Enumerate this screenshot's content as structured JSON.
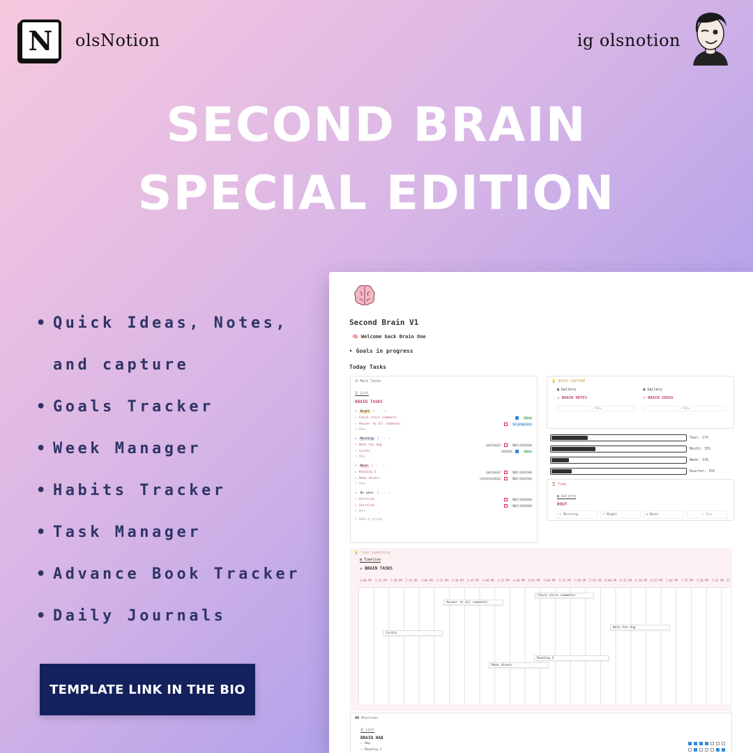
{
  "brand": {
    "logo_letter": "N",
    "name": "olsNotion"
  },
  "handle": "ig olsnotion",
  "title": {
    "line1": "SECOND BRAIN",
    "line2": "SPECIAL EDITION"
  },
  "features": [
    "Quick Ideas, Notes, and capture",
    "Goals Tracker",
    "Week Manager",
    "Habits Tracker",
    "Task Manager",
    "Advance Book Tracker",
    "Daily Journals"
  ],
  "cta": "TEMPLATE LINK IN THE BIO",
  "colors": {
    "cta_bg": "#14215c",
    "feature_text": "#2f3466",
    "accent_pink": "#c4457a"
  },
  "screenshot": {
    "page_title": "Second Brain V1",
    "welcome": "🧠 Welcome back Brain One",
    "goals": "‣ Goals in progress",
    "today": "Today Tasks",
    "main_tasks": {
      "view_label": "☰ Main Tasks",
      "tab": "☰ List",
      "heading": "BRAIN TASKS",
      "groups": [
        {
          "label": "Night",
          "color": "#f6e2b8",
          "items": [
            {
              "name": "Check store comments",
              "tag": "",
              "checked": true,
              "status": "Done",
              "kind": "done"
            },
            {
              "name": "Answer to all comments",
              "tag": "",
              "checked": false,
              "status": "In progress",
              "kind": "prog"
            }
          ]
        },
        {
          "label": "Morning",
          "color": "#dbe6f5",
          "items": [
            {
              "name": "Walk the dog",
              "tag": "personal",
              "checked": false,
              "status": "Not started",
              "kind": "ns"
            },
            {
              "name": "Cardio",
              "tag": "health",
              "checked": true,
              "status": "Done",
              "kind": "done"
            }
          ]
        },
        {
          "label": "Noon",
          "color": "#f8d9d9",
          "items": [
            {
              "name": "Reading 2",
              "tag": "personal",
              "checked": false,
              "status": "Not started",
              "kind": "ns"
            },
            {
              "name": "Make dinner",
              "tag": "relationship",
              "checked": false,
              "status": "Not started",
              "kind": "ns"
            }
          ]
        },
        {
          "label": "No when",
          "color": "#fff",
          "items": [
            {
              "name": "Untitled",
              "tag": "",
              "checked": false,
              "status": "Not started",
              "kind": "ns"
            },
            {
              "name": "Untitled",
              "tag": "",
              "checked": false,
              "status": "Not started",
              "kind": "ns"
            }
          ]
        }
      ],
      "add_group": "+ Add a group",
      "new": "+ New"
    },
    "quick_capture": {
      "label": "💡 QUICK CAPTURE",
      "gallery_a": "▦ Gallery",
      "gallery_b": "▦ Gallery",
      "notes": "↗ BRAIN NOTES",
      "ideas": "↗ BRAIN IDEAS",
      "new": "+ New"
    },
    "progress": [
      {
        "label": "Year: 27%",
        "value": 27
      },
      {
        "label": "Month: 33%",
        "value": 33
      },
      {
        "label": "Week: 13%",
        "value": 13
      },
      {
        "label": "Quarter: 15%",
        "value": 15
      }
    ],
    "time_box": {
      "label": "⏳ Time",
      "tab": "▦ Gallery",
      "heading": "ROUT",
      "cards": [
        "☀ Morning",
        "☾ Night",
        "◷ Noon",
        "+ New"
      ]
    },
    "timeline": {
      "placeholder": "💡 Type something...",
      "tab": "▤ Timeline",
      "heading": "↗ BRAIN TASKS",
      "times": [
        "2:00 PM",
        "2:15 PM",
        "2:30 PM",
        "2:45 PM",
        "3:00 PM",
        "3:15 PM",
        "3:30 PM",
        "3:45 PM",
        "4:00 PM",
        "4:15 PM",
        "4:30 PM",
        "4:45 PM",
        "5:00 PM",
        "5:15 PM",
        "5:30 PM",
        "5:45 PM",
        "6:00 PM",
        "6:15 PM",
        "6:30 PM",
        "6:45 PM",
        "7:00 PM",
        "7:15 PM",
        "7:30 PM",
        "7:45 PM",
        "8:"
      ],
      "items": [
        "Check store comments",
        "Answer to all comments",
        "Cardio",
        "Walk the dog",
        "Reading 2",
        "Make dinner"
      ]
    },
    "routines": {
      "label": "📼 Routines",
      "tab": "☰ List",
      "heading": "BRAIN HAB",
      "rows": [
        {
          "name": "Nap",
          "checks": [
            true,
            true,
            true,
            true,
            false,
            false,
            false
          ]
        },
        {
          "name": "Reading 2",
          "checks": [
            false,
            true,
            false,
            false,
            false,
            true,
            true
          ]
        }
      ]
    }
  }
}
